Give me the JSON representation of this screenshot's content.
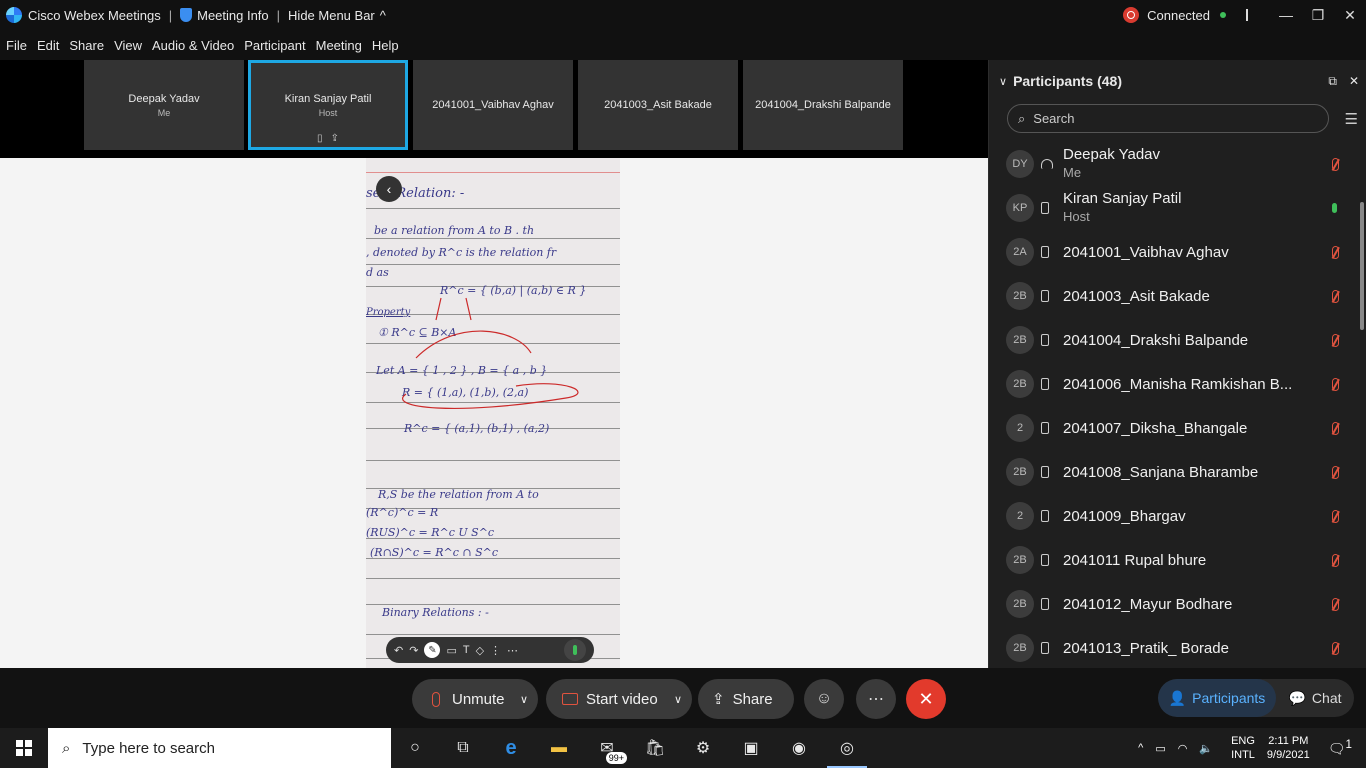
{
  "titlebar": {
    "app_name": "Cisco Webex Meetings",
    "meeting_info": "Meeting Info",
    "hide_menu": "Hide Menu Bar",
    "status": "Connected"
  },
  "menu": [
    "File",
    "Edit",
    "Share",
    "View",
    "Audio & Video",
    "Participant",
    "Meeting",
    "Help"
  ],
  "video_strip": [
    {
      "name": "Deepak Yadav",
      "sub": "Me"
    },
    {
      "name": "Kiran Sanjay Patil",
      "sub": "Host"
    },
    {
      "name": "2041001_Vaibhav Aghav",
      "sub": ""
    },
    {
      "name": "2041003_Asit Bakade",
      "sub": ""
    },
    {
      "name": "2041004_Drakshi Balpande",
      "sub": ""
    }
  ],
  "doc_text": {
    "t1": "se  a Relation: -",
    "t2": "be  a relation  from  A to B . th",
    "t3": ", denoted by   R^c  is the relation  fr",
    "t4": "d as",
    "t5": "R^c = { (b,a) | (a,b) ∈ R }",
    "t6": "Property",
    "t7": "① R^c  ⊆  B×A",
    "t8": "Let  A = { 1 , 2 } ,   B = { a , b }",
    "t9": "R = { (1,a), (1,b), (2,a)",
    "t10": "R^c = { (a,1), (b,1) , (a,2)",
    "t11": "R,S be   the relation  from  A to",
    "t12": "(R^c)^c = R",
    "t13": "(RUS)^c = R^c U S^c",
    "t14": "(R∩S)^c = R^c ∩ S^c",
    "t15": "Binary  Relations : -"
  },
  "panel": {
    "title": "Participants (48)",
    "search_placeholder": "Search",
    "participants": [
      {
        "initials": "DY",
        "name": "Deepak Yadav",
        "role": "Me"
      },
      {
        "initials": "KP",
        "name": "Kiran Sanjay Patil",
        "role": "Host"
      },
      {
        "initials": "2A",
        "name": "2041001_Vaibhav Aghav",
        "role": ""
      },
      {
        "initials": "2B",
        "name": "2041003_Asit Bakade",
        "role": ""
      },
      {
        "initials": "2B",
        "name": "2041004_Drakshi Balpande",
        "role": ""
      },
      {
        "initials": "2B",
        "name": "2041006_Manisha Ramkishan B...",
        "role": ""
      },
      {
        "initials": "2",
        "name": "2041007_Diksha_Bhangale",
        "role": ""
      },
      {
        "initials": "2B",
        "name": "2041008_Sanjana Bharambe",
        "role": ""
      },
      {
        "initials": "2",
        "name": "2041009_Bhargav",
        "role": ""
      },
      {
        "initials": "2B",
        "name": "2041011 Rupal bhure",
        "role": ""
      },
      {
        "initials": "2B",
        "name": "2041012_Mayur Bodhare",
        "role": ""
      },
      {
        "initials": "2B",
        "name": "2041013_Pratik_ Borade",
        "role": ""
      }
    ]
  },
  "controls": {
    "unmute": "Unmute",
    "start_video": "Start video",
    "share": "Share",
    "participants": "Participants",
    "chat": "Chat"
  },
  "taskbar": {
    "search_placeholder": "Type here to search",
    "mail_badge": "99+",
    "lang1": "ENG",
    "lang2": "INTL",
    "time": "2:11 PM",
    "date": "9/9/2021",
    "notif_count": "1"
  }
}
